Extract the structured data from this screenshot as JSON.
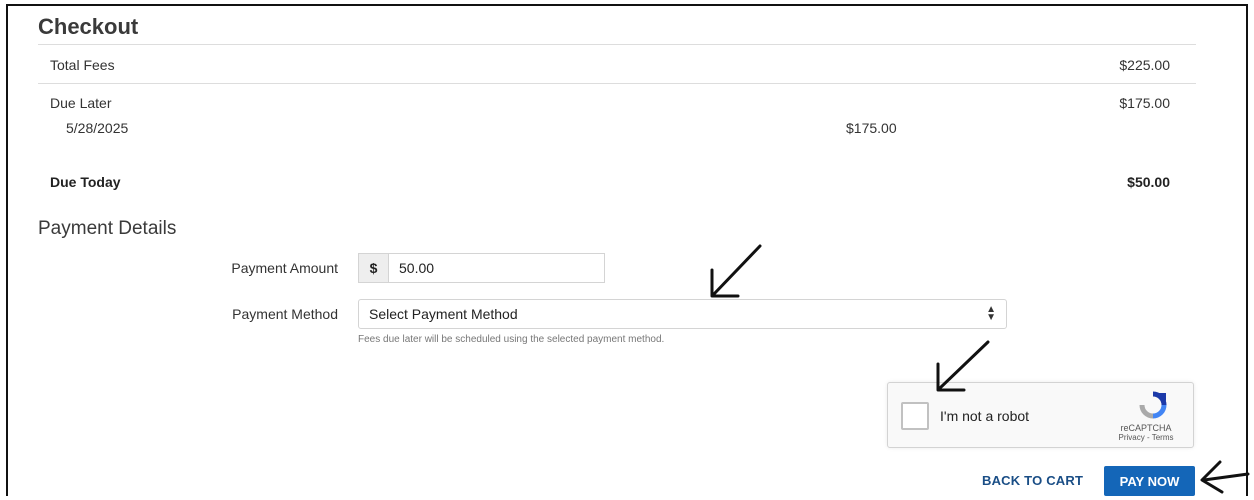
{
  "checkout": {
    "title": "Checkout",
    "total_fees": {
      "label": "Total Fees",
      "amount": "$225.00"
    },
    "due_later": {
      "label": "Due Later",
      "amount": "$175.00",
      "date": "5/28/2025",
      "date_amount": "$175.00"
    },
    "due_today": {
      "label": "Due Today",
      "amount": "$50.00"
    }
  },
  "payment": {
    "title": "Payment Details",
    "amount_label": "Payment Amount",
    "currency_symbol": "$",
    "amount_value": "50.00",
    "method_label": "Payment Method",
    "method_selected": "Select Payment Method",
    "method_help": "Fees due later will be scheduled using the selected payment method."
  },
  "captcha": {
    "label": "I'm not a robot",
    "brand": "reCAPTCHA",
    "links": "Privacy - Terms",
    "icon": "recaptcha-logo-icon"
  },
  "actions": {
    "back_label": "BACK TO CART",
    "pay_label": "PAY NOW"
  },
  "colors": {
    "primary": "#1466b8",
    "link": "#1a4e86"
  }
}
